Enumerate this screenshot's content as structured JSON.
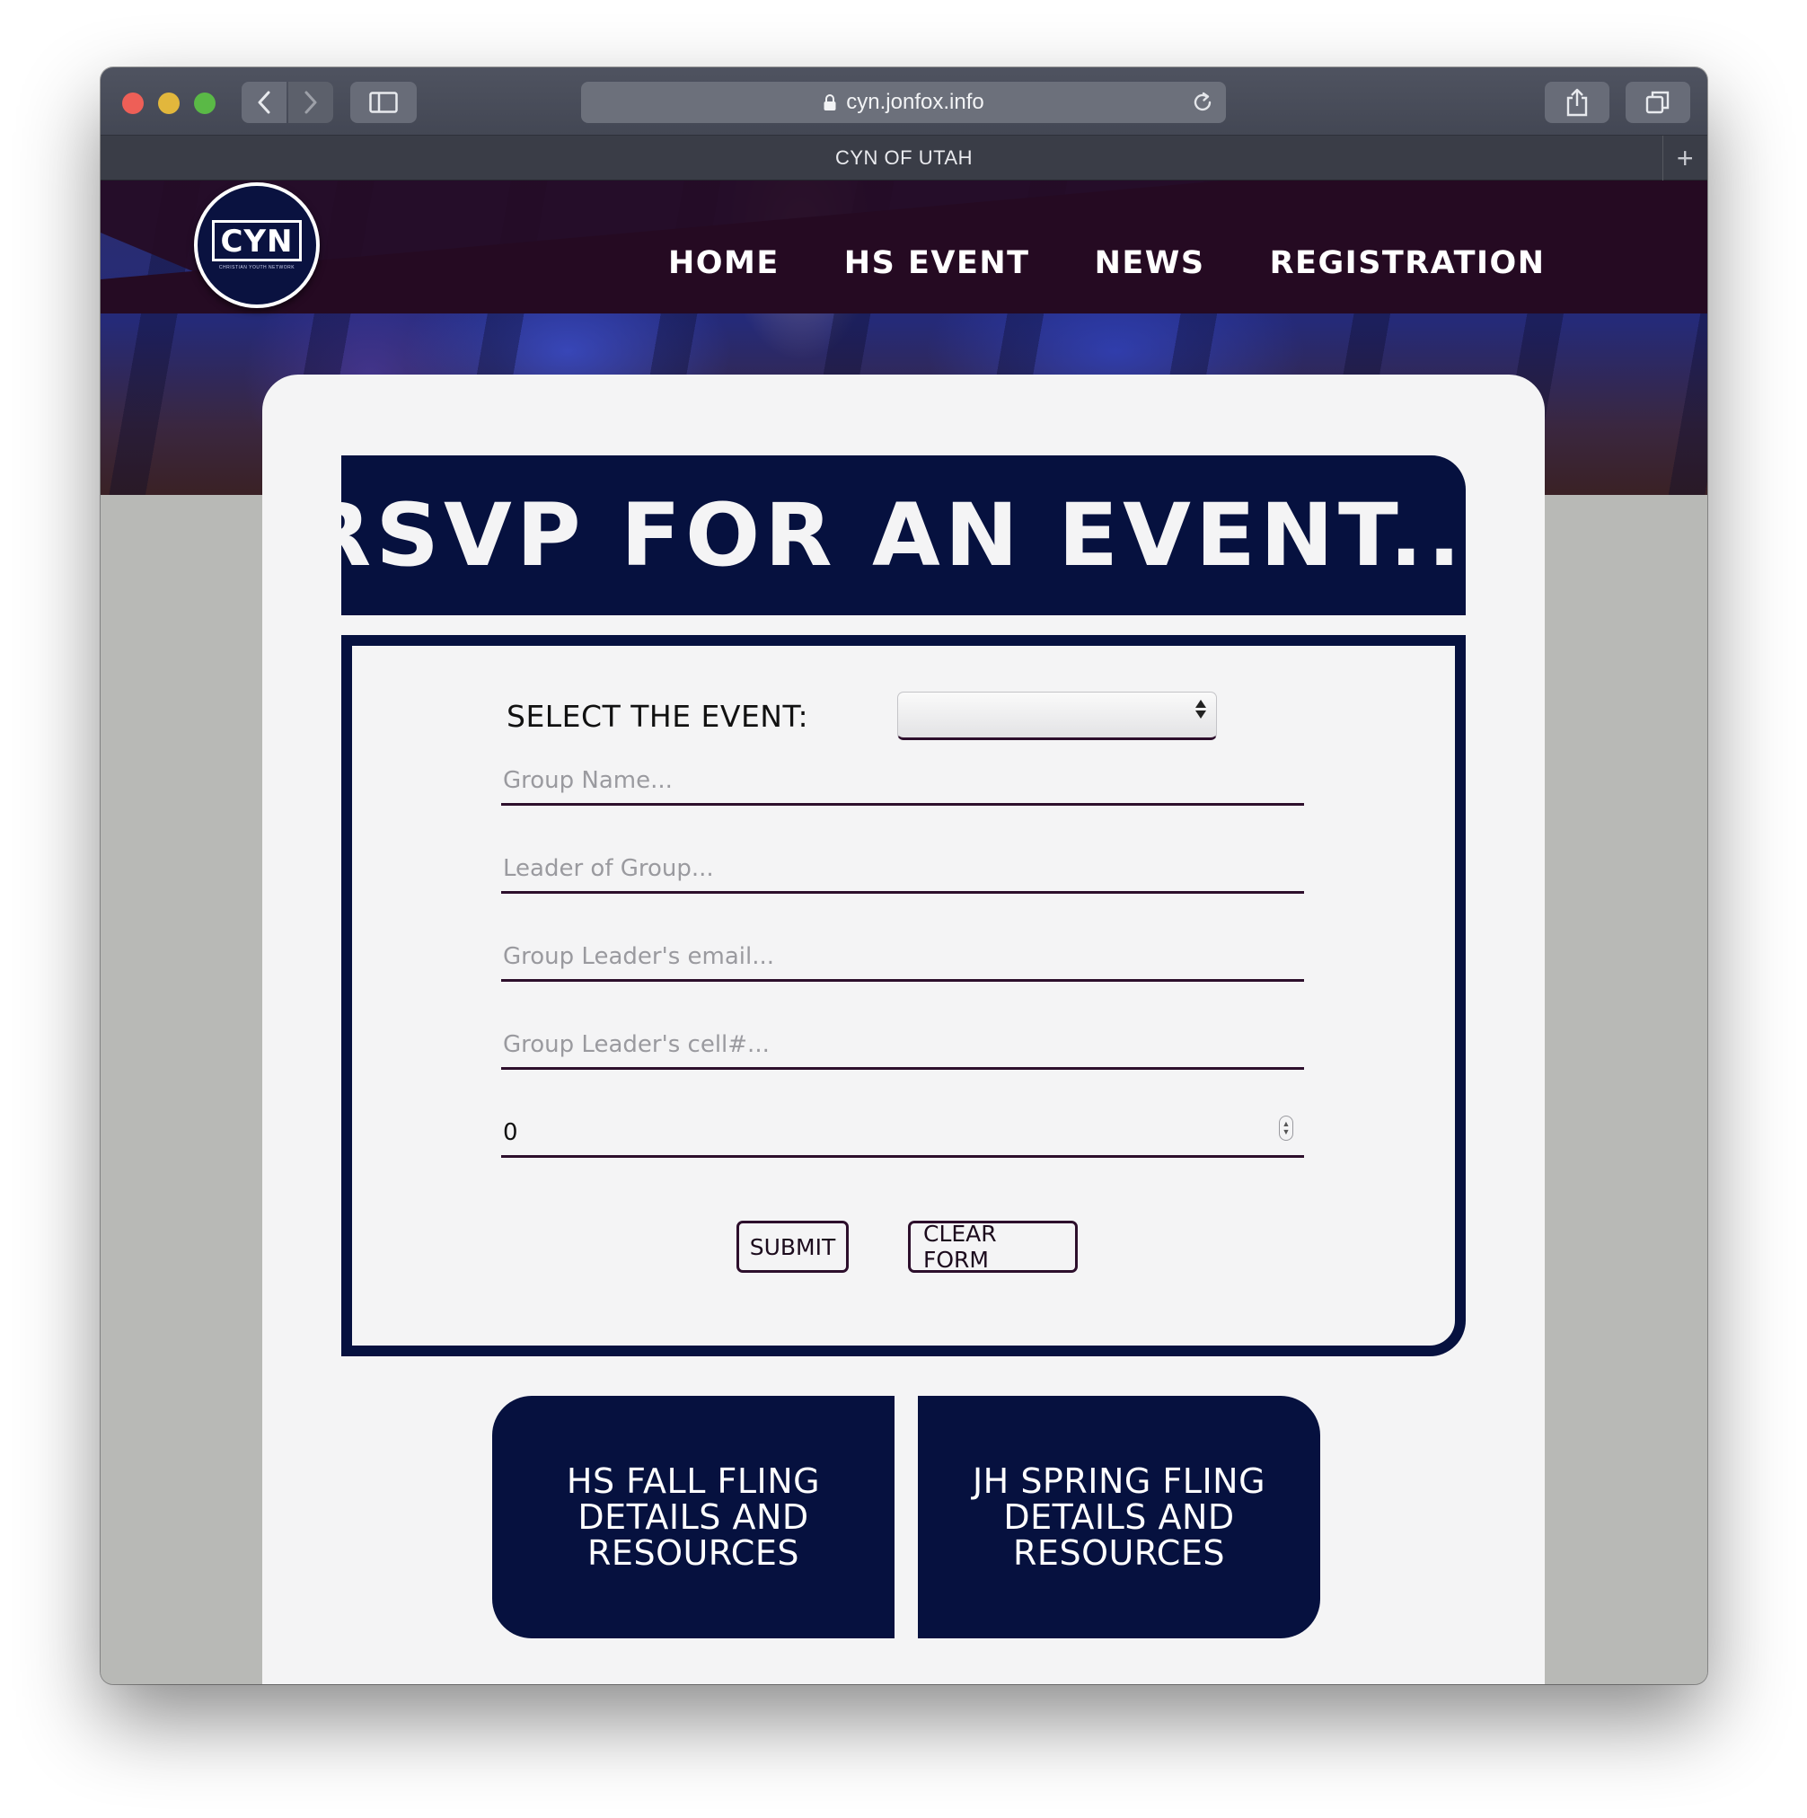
{
  "browser": {
    "url": "cyn.jonfox.info",
    "tab_title": "CYN OF UTAH"
  },
  "site": {
    "logo_text": "CYN",
    "logo_subtitle": "CHRISTIAN YOUTH NETWORK",
    "nav": [
      "HOME",
      "HS EVENT",
      "NEWS",
      "REGISTRATION"
    ]
  },
  "form": {
    "title": "RSVP FOR AN EVENT...",
    "select_label": "SELECT THE EVENT:",
    "select_value": "",
    "fields": [
      {
        "placeholder": "Group Name...",
        "value": ""
      },
      {
        "placeholder": "Leader of Group...",
        "value": ""
      },
      {
        "placeholder": "Group Leader's email...",
        "value": ""
      },
      {
        "placeholder": "Group Leader's cell#...",
        "value": ""
      }
    ],
    "count_value": "0",
    "submit_label": "SUBMIT",
    "clear_label": "CLEAR FORM"
  },
  "tiles": [
    "HS FALL FLING DETAILS AND RESOURCES",
    "JH SPRING FLING DETAILS AND RESOURCES"
  ],
  "colors": {
    "navy": "#06113f",
    "nav_bg": "#250b23",
    "card_bg": "#f4f4f5"
  }
}
